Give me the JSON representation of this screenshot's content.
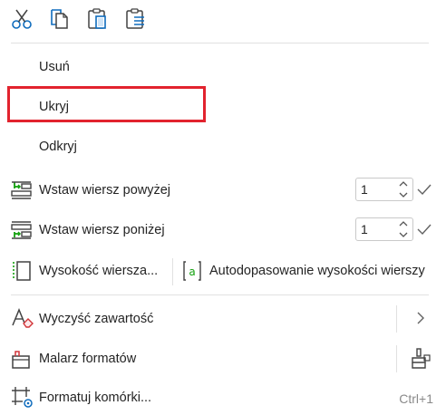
{
  "toolbar": {
    "icons": [
      "scissors-icon",
      "copy-icon",
      "paste-icon",
      "paste-special-icon"
    ]
  },
  "menu": {
    "delete_label": "Usuń",
    "hide_label": "Ukryj",
    "unhide_label": "Odkryj",
    "insert_above": {
      "label": "Wstaw wiersz powyżej",
      "value": "1"
    },
    "insert_below": {
      "label": "Wstaw wiersz poniżej",
      "value": "1"
    },
    "row_height_label": "Wysokość wiersza...",
    "autofit_label": "Autodopasowanie wysokości wierszy",
    "clear_contents_label": "Wyczyść zawartość",
    "format_painter_label": "Malarz formatów",
    "format_cells": {
      "label": "Formatuj komórki...",
      "shortcut": "Ctrl+1"
    }
  },
  "colors": {
    "accent": "#0f6cbd",
    "highlight_border": "#e2232e",
    "insert_green": "#13a10e",
    "clear_red": "#d13438"
  }
}
